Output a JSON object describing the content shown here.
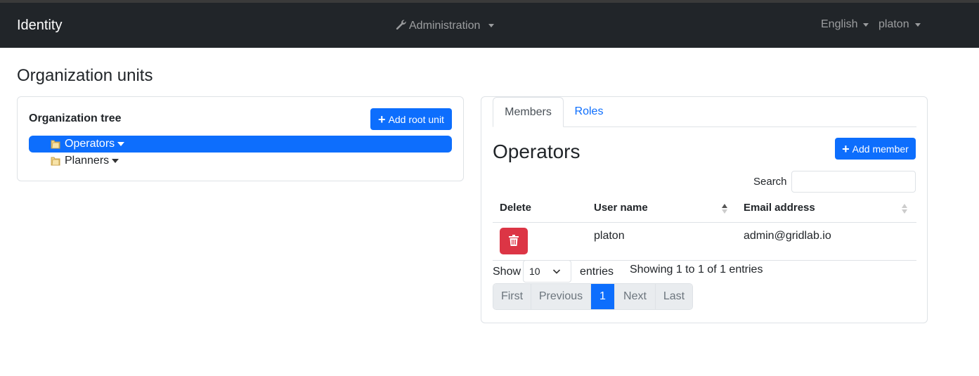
{
  "navbar": {
    "brand": "Identity",
    "admin_menu": "Administration",
    "language": "English",
    "user": "platon",
    "colors": {
      "bg": "#212529",
      "text_muted": "rgba(255,255,255,.55)"
    },
    "icons": {
      "admin": "wrench-icon"
    }
  },
  "page": {
    "title": "Organization units"
  },
  "tree": {
    "title": "Organization tree",
    "add_root_label": "Add root unit",
    "items": [
      {
        "label": "Operators",
        "selected": true
      },
      {
        "label": "Planners",
        "selected": false
      }
    ]
  },
  "details": {
    "tabs": [
      {
        "label": "Members",
        "active": true
      },
      {
        "label": "Roles",
        "active": false
      }
    ],
    "unit_name": "Operators",
    "add_member_label": "Add member",
    "search_label": "Search",
    "search_value": "",
    "table": {
      "columns": [
        "Delete",
        "User name",
        "Email address"
      ],
      "rows": [
        {
          "user_name": "platon",
          "email": "admin@gridlab.io"
        }
      ]
    },
    "length": {
      "show": "Show",
      "value": "10",
      "entries": "entries"
    },
    "info": "Showing 1 to 1 of 1 entries",
    "pagination": [
      "First",
      "Previous",
      "1",
      "Next",
      "Last"
    ],
    "current_page": "1"
  },
  "colors": {
    "primary": "#0d6efd",
    "danger": "#dc3545",
    "border": "#dee2e6"
  }
}
